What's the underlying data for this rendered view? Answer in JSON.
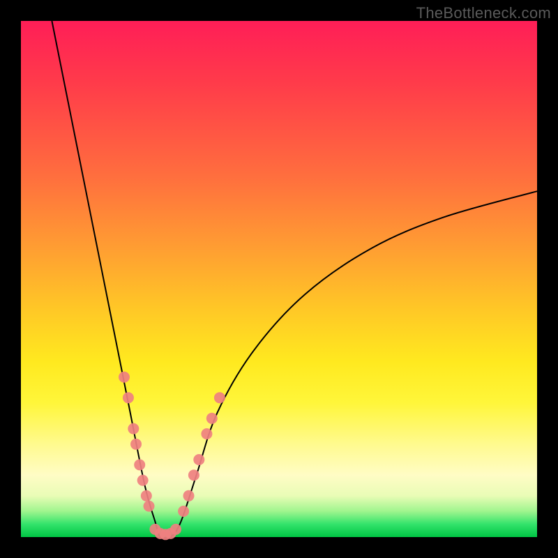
{
  "watermark": "TheBottleneck.com",
  "chart_data": {
    "type": "line",
    "title": "",
    "xlabel": "",
    "ylabel": "",
    "xlim": [
      0,
      100
    ],
    "ylim": [
      0,
      100
    ],
    "grid": false,
    "curve_note": "V-shaped bottleneck curve with minimum at x≈27, y≈0; left branch reaches y≈100 at x≈6; right branch reaches y≈67 at x≈100.",
    "curve_points": [
      {
        "x": 6,
        "y": 100
      },
      {
        "x": 10,
        "y": 80
      },
      {
        "x": 14,
        "y": 60
      },
      {
        "x": 18,
        "y": 40
      },
      {
        "x": 21,
        "y": 25
      },
      {
        "x": 24,
        "y": 10
      },
      {
        "x": 26,
        "y": 3
      },
      {
        "x": 27,
        "y": 0
      },
      {
        "x": 29,
        "y": 0
      },
      {
        "x": 31,
        "y": 3
      },
      {
        "x": 34,
        "y": 12
      },
      {
        "x": 38,
        "y": 24
      },
      {
        "x": 45,
        "y": 36
      },
      {
        "x": 55,
        "y": 47
      },
      {
        "x": 68,
        "y": 56
      },
      {
        "x": 82,
        "y": 62
      },
      {
        "x": 100,
        "y": 67
      }
    ],
    "dots_left": [
      {
        "x": 20.0,
        "y": 31
      },
      {
        "x": 20.8,
        "y": 27
      },
      {
        "x": 21.8,
        "y": 21
      },
      {
        "x": 22.3,
        "y": 18
      },
      {
        "x": 23.0,
        "y": 14
      },
      {
        "x": 23.6,
        "y": 11
      },
      {
        "x": 24.3,
        "y": 8
      },
      {
        "x": 24.8,
        "y": 6
      }
    ],
    "dots_right": [
      {
        "x": 31.5,
        "y": 5
      },
      {
        "x": 32.5,
        "y": 8
      },
      {
        "x": 33.5,
        "y": 12
      },
      {
        "x": 34.5,
        "y": 15
      },
      {
        "x": 36.0,
        "y": 20
      },
      {
        "x": 37.0,
        "y": 23
      },
      {
        "x": 38.5,
        "y": 27
      }
    ],
    "dots_bottom": [
      {
        "x": 26.0,
        "y": 1.5
      },
      {
        "x": 27.0,
        "y": 0.7
      },
      {
        "x": 28.0,
        "y": 0.5
      },
      {
        "x": 29.0,
        "y": 0.7
      },
      {
        "x": 30.0,
        "y": 1.5
      }
    ]
  }
}
